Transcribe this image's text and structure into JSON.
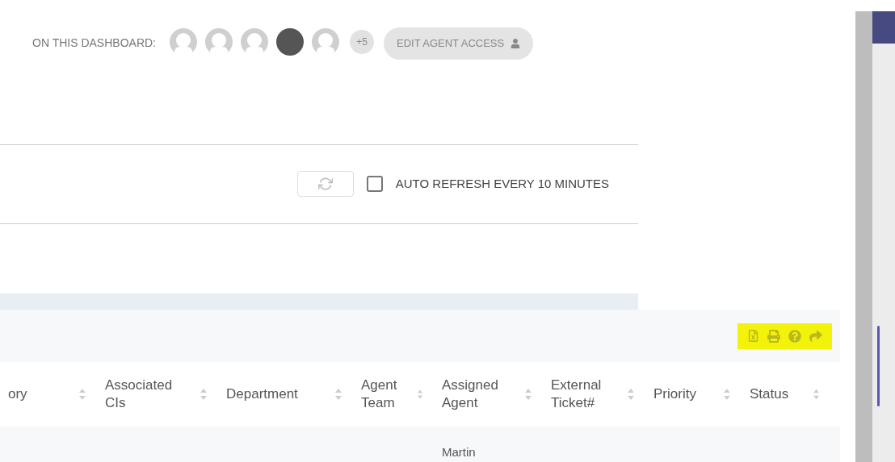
{
  "dashboard_viewers": {
    "label": "ON THIS DASHBOARD:",
    "avatars": [
      {
        "kind": "silhouette"
      },
      {
        "kind": "silhouette"
      },
      {
        "kind": "silhouette"
      },
      {
        "kind": "dark"
      },
      {
        "kind": "silhouette"
      }
    ],
    "more_count": "+5",
    "edit_button": "EDIT AGENT ACCESS"
  },
  "refresh": {
    "auto_refresh_label": "AUTO REFRESH EVERY 10 MINUTES",
    "checked": false
  },
  "toolbar": {
    "highlighted": true
  },
  "table": {
    "columns": [
      {
        "label": "ory"
      },
      {
        "label": "Associated CIs"
      },
      {
        "label": "Department"
      },
      {
        "label": "Agent Team"
      },
      {
        "label": "Assigned Agent"
      },
      {
        "label": "External Ticket#"
      },
      {
        "label": "Priority"
      },
      {
        "label": "Status"
      }
    ],
    "rows": [
      {
        "cells": [
          "",
          "",
          "",
          "",
          "Martin",
          "",
          "",
          ""
        ]
      }
    ]
  }
}
